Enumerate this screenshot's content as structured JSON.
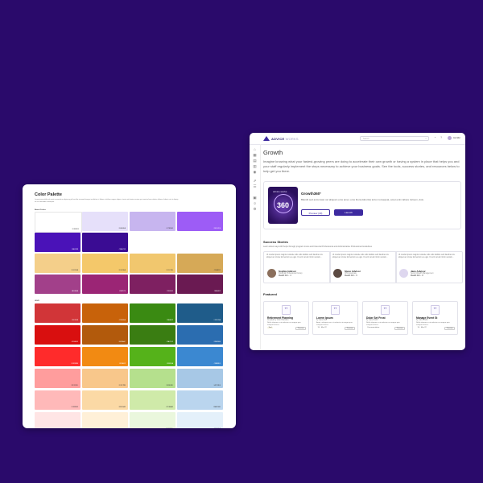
{
  "palette": {
    "title": "Color Palette",
    "description": "Lorem ipsum dolor sit amet consectetur adipiscing elit sed do eiusmod tempor incididunt ut labore et dolore magna aliqua ut enim ad minim veniam quis nostrud exercitation ullamco laboris nisi ut aliquip ex ea commodo consequat.",
    "section_brand": "Brand Colors",
    "section_ui": "UI/UX",
    "brand_rows": [
      [
        "#ffffff",
        "#e6e0fa",
        "#c7b5ef",
        "#9d5cf6"
      ],
      [
        "#4a12b8",
        "#3a0c93"
      ],
      [
        "#f4cf8a",
        "#f4c86a",
        "#f1c76e",
        "#d6a957"
      ],
      [
        "#a2408a",
        "#9b2575",
        "#7e2061",
        "#6a1a52"
      ]
    ],
    "ui_rows": [
      [
        "#d13538",
        "#c8620a",
        "#3a8a12",
        "#1f5c8a"
      ],
      [
        "#d90f0f",
        "#b25a0c",
        "#3a7d12",
        "#2b6db0"
      ],
      [
        "#ff2b2b",
        "#f28a12",
        "#55b21a",
        "#3b88d1"
      ],
      [
        "#ff9d9d",
        "#f8c78b",
        "#b5e08d",
        "#a7c8e6"
      ],
      [
        "#ffb9b9",
        "#fbd9a5",
        "#cfeaa9",
        "#bad5ee"
      ],
      [
        "#ffe5e5",
        "#fff0d8",
        "#eaf7dd",
        "#e4f0fa"
      ]
    ]
  },
  "app": {
    "brand_name": "ADVICE",
    "brand_suffix": "WORKS",
    "search_placeholder": "Search",
    "user_name": "Jennifer",
    "page_title": "Growth",
    "page_description": "Imagine knowing what your fastest-growing peers are doing to accelerate their own growth or having a system in place that helps you and your staff regularly implement the steps necessary to achieve your business goals. See the tools, success stories, and resources below to help get you there.",
    "feature": {
      "badge_top": "advice works",
      "badge_main": "360",
      "title": "Growth360°",
      "description": "Blandit sed accumsan vel aliquam eros amet, eros litora (lobortis) tortor consequat, amet enim labore lorisem, duis.",
      "preview_label": "Preview (29)",
      "launch_label": "Launch"
    },
    "stories_title": "Success Stories",
    "stories_subtitle": "Learn about ways AW helps through program trusts and Financial Professional and Administrative Professional Guidelines",
    "stories": [
      {
        "quote": "Ut conduit ipsum magnis molestie odio odio facilisis velit faucibus nis aliquet ac ornare fermentum eu eget. Ut enim at ad minim veniam...",
        "name": "Sophia Advisor",
        "role": "Financial Professional Group",
        "company": "Wealth Firm · 4"
      },
      {
        "quote": "Ut conduit ipsum magnis molestie odio odio facilisis velit faucibus nis aliquet ac ornare fermentum eu eget. Ut enim at ad minim veniam...",
        "name": "Steve Advisor",
        "role": "CPA Associate",
        "company": "Wealth Firm · 6"
      },
      {
        "quote": "Ut conduit ipsum magnis molestie odio odio facilisis velit faucibus nis aliquet ac ornare fermentum eu eget. Ut enim at ad minim veniam...",
        "name": "Jane Advisor",
        "role": "Senior Wealth Management",
        "company": "Wealth Firm · 8"
      }
    ],
    "featured_title": "Featured",
    "featured": [
      {
        "thumb": "TT",
        "title": "Retirement Planning",
        "author": "Created by John Hamilton",
        "desc": "Nulla aliquam in ut molestie eu magna quis volutpat massa.",
        "tag": "Tool",
        "view": "Preview"
      },
      {
        "thumb": "TT",
        "title": "Lorem Ipsum",
        "author": "by Jane Doe",
        "desc": "Amet, volutpat nunc ut molestie ut magna quis volutpat massa.",
        "tag": "15 · Mar 22",
        "view": "Preview"
      },
      {
        "thumb": "TT",
        "title": "Dolar Set Frost",
        "author": "by Jane Smith",
        "desc": "Nulla aliquam in ut molestie eu magna quis volutpat massa.",
        "tag": "Documentation",
        "view": "Preview"
      },
      {
        "thumb": "TT",
        "title": "Manage Event St",
        "author": "by John Smith",
        "desc": "Nulla aliquam in ut molestie eu magna quis volutpat massa.",
        "tag": "15 · Mar 22",
        "view": "Preview"
      }
    ]
  }
}
